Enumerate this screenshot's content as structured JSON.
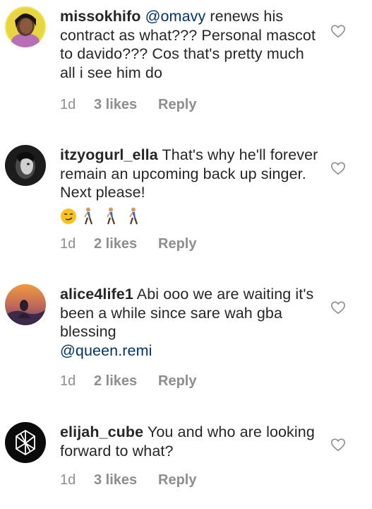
{
  "comments": [
    {
      "username": "missokhifo",
      "mention": "@omavy",
      "text_after_mention": " renews his contract as what??? Personal mascot to davido??? Cos that's pretty much all i see him do",
      "time": "1d",
      "likes": "3 likes",
      "reply": "Reply",
      "avatar_icon": "profile-photo-woman"
    },
    {
      "username": "itzyogurl_ella",
      "text": " That's why he'll forever remain an upcoming back up singer. Next please!",
      "emojis": [
        "smirking-face",
        "person-walking",
        "person-walking",
        "person-walking"
      ],
      "time": "1d",
      "likes": "2 likes",
      "reply": "Reply",
      "avatar_icon": "profile-photo-monochrome"
    },
    {
      "username": "alice4life1",
      "text": " Abi ooo we are waiting it's been a while since sare wah gba blessing",
      "mention": "@queen.remi",
      "time": "1d",
      "likes": "2 likes",
      "reply": "Reply",
      "avatar_icon": "profile-photo-sunset"
    },
    {
      "username": "elijah_cube",
      "text": " You and who are looking forward to what?",
      "time": "1d",
      "likes": "3 likes",
      "reply": "Reply",
      "avatar_icon": "profile-logo-geometric"
    }
  ],
  "colors": {
    "username": "#262626",
    "text": "#262626",
    "mention": "#003569",
    "meta": "#8e8e8e",
    "heart_stroke": "#8e8e8e"
  }
}
